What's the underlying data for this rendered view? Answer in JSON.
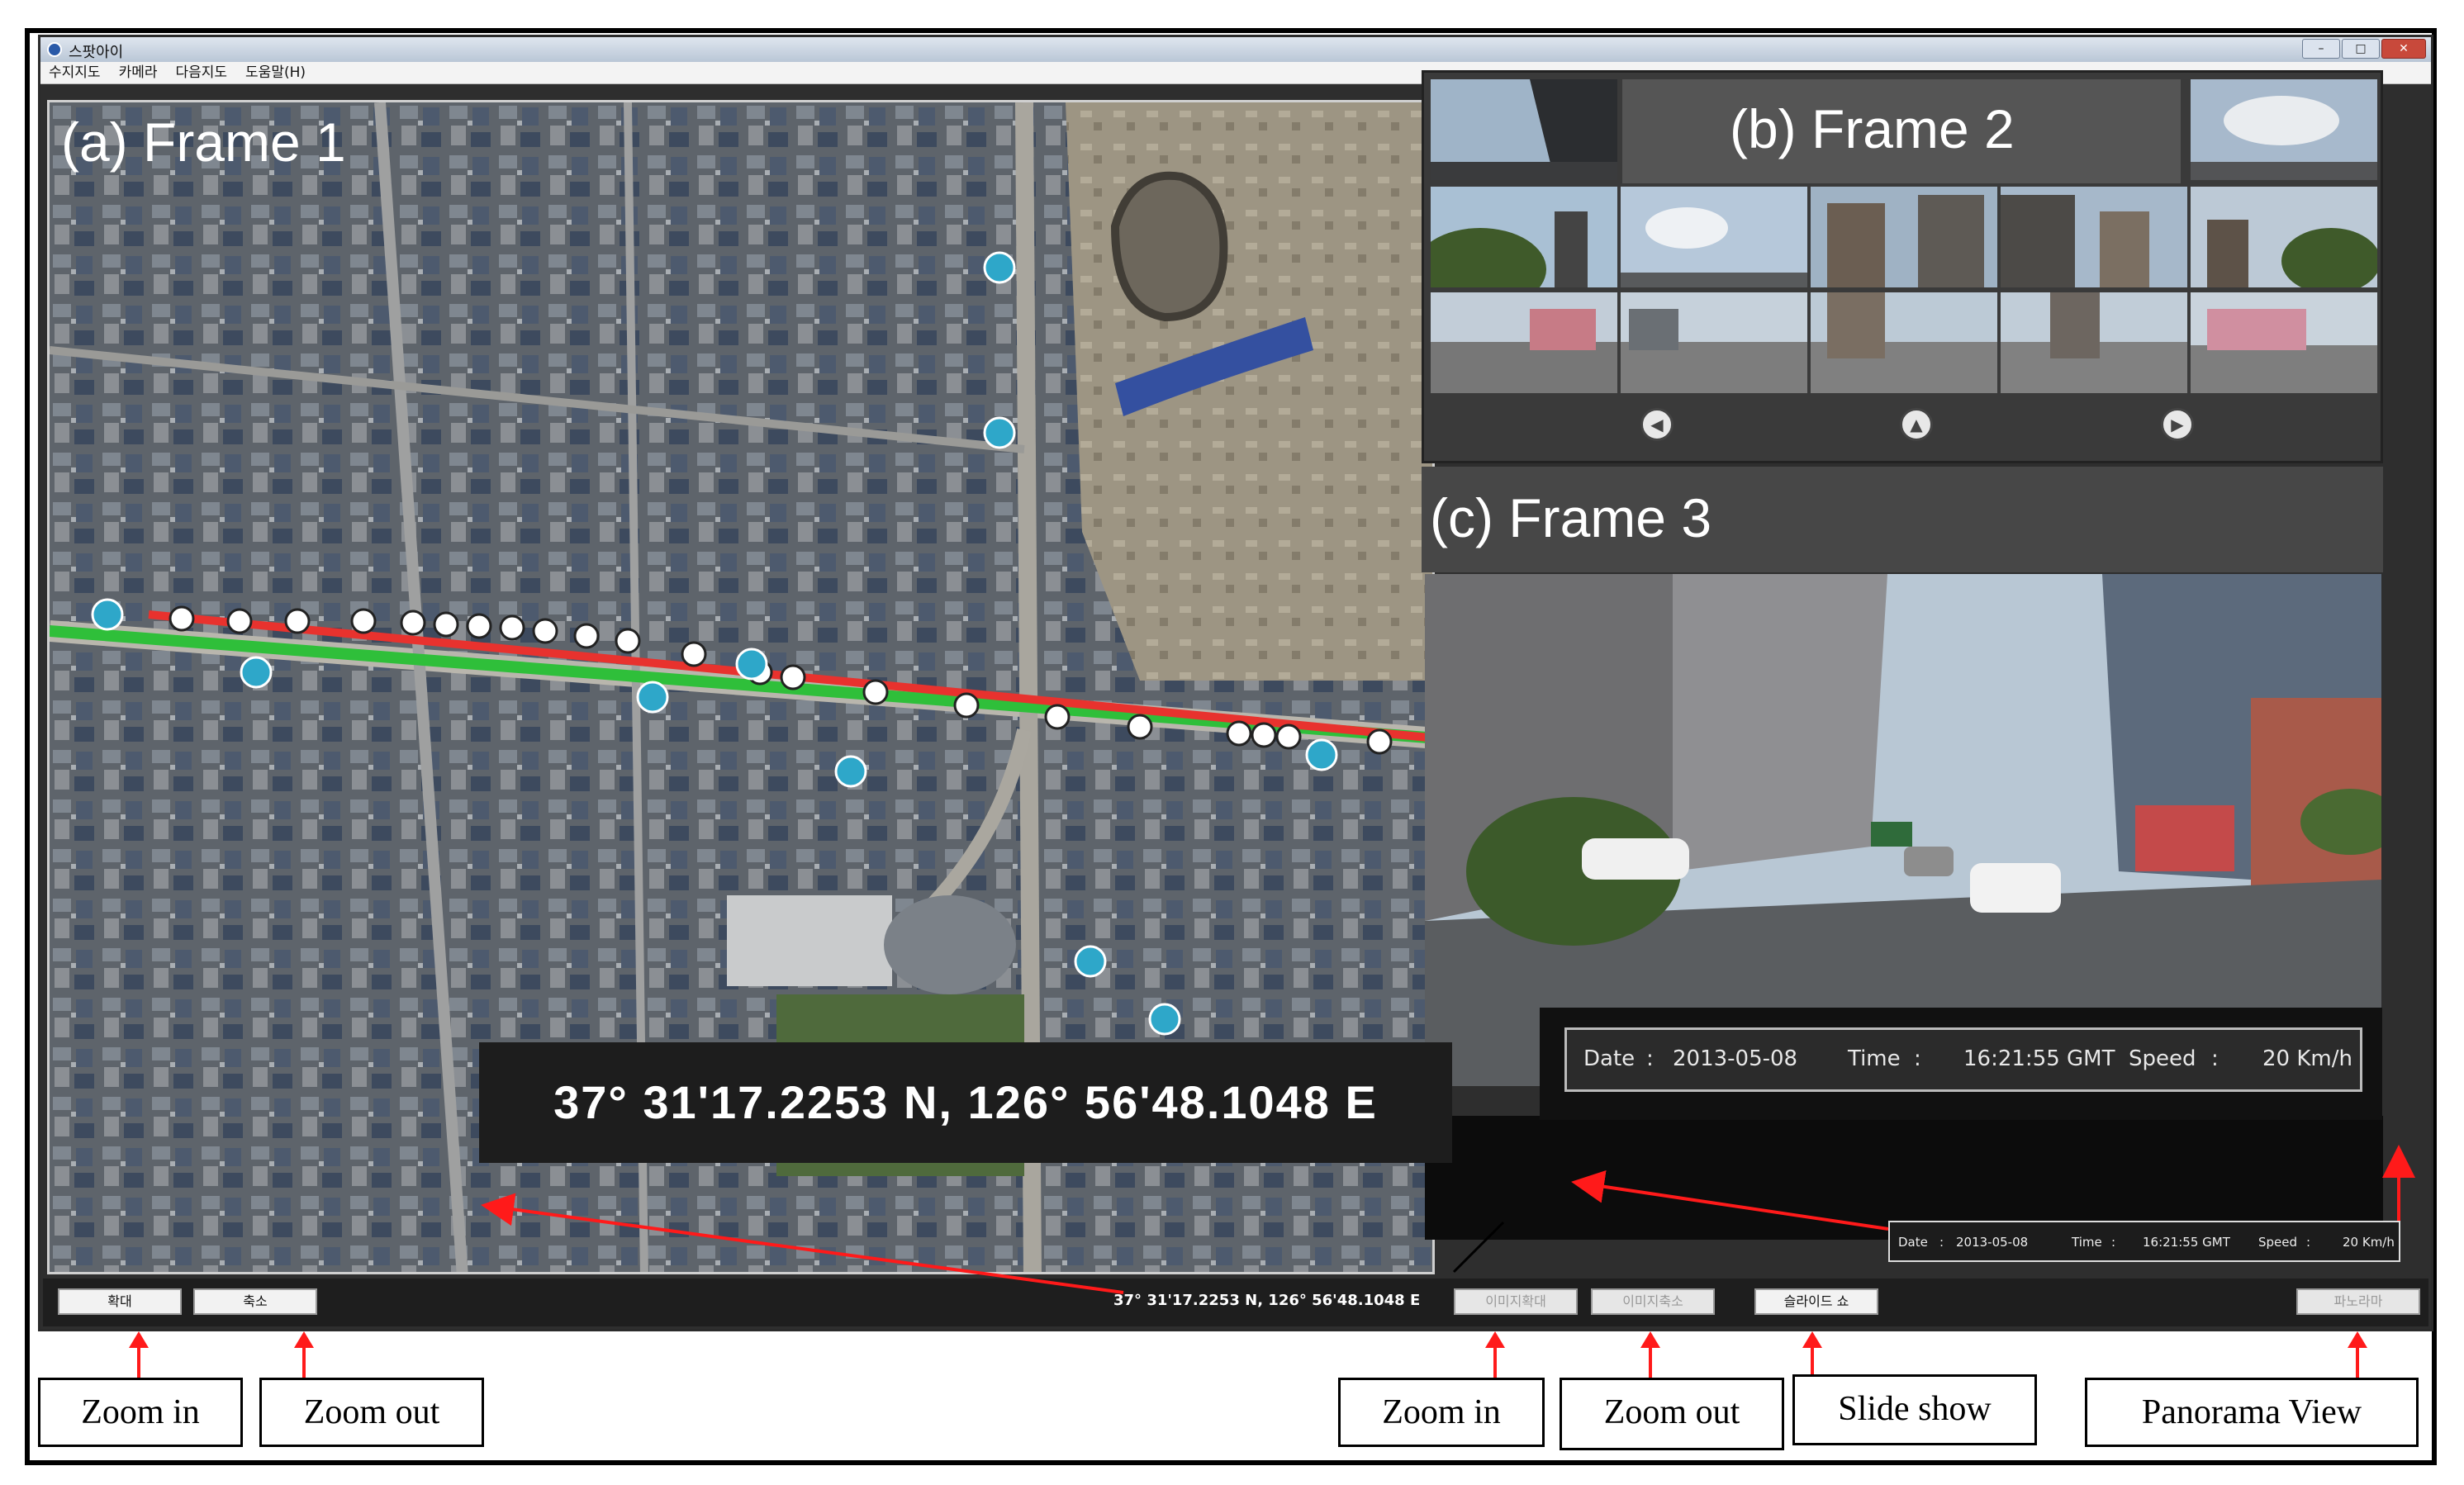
{
  "window": {
    "title": "스팟아이",
    "controls": [
      "–",
      "□",
      "✕"
    ]
  },
  "menu": [
    "수지지도",
    "카메라",
    "다음지도",
    "도움말(H)"
  ],
  "frames": {
    "frame1_label": "(a) Frame 1",
    "frame2_label": "(b) Frame 2",
    "frame3_label": "(c) Frame 3"
  },
  "coords": {
    "big": "37°  31'17.2253 N,   126°  56'48.1048 E",
    "small": "37°  31'17.2253 N,   126°  56'48.1048 E"
  },
  "info": {
    "date_label": "Date",
    "date_value": "2013-05-08",
    "time_label": "Time",
    "time_value": "16:21:55 GMT",
    "speed_label": "Speed",
    "speed_value": "20  Km/h",
    "sep": ":"
  },
  "buttons": {
    "zoom_in": "확대",
    "zoom_out": "축소",
    "img_zoom_in": "이미지확대",
    "img_zoom_out": "이미지축소",
    "slideshow": "슬라이드 쇼",
    "panorama": "파노라마"
  },
  "annotations": {
    "zoom_in_1": "Zoom in",
    "zoom_out_1": "Zoom out",
    "zoom_in_2": "Zoom in",
    "zoom_out_2": "Zoom out",
    "slideshow": "Slide show",
    "panorama": "Panorama View"
  },
  "nav": {
    "prev_icon": "chevron-left-icon",
    "up_icon": "chevron-up-icon",
    "next_icon": "chevron-right-icon",
    "prev": "◀",
    "up": "▲",
    "next": "▶"
  },
  "colors": {
    "route_red": "#e8322e",
    "route_green": "#2fbf3a",
    "arrow_red": "#ff1a1a"
  }
}
